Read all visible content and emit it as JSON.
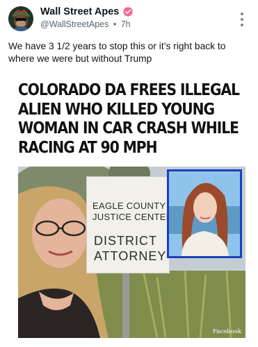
{
  "post": {
    "display_name": "Wall Street Apes",
    "handle": "@WallStreetApes",
    "separator": "•",
    "timestamp": "7h",
    "text": "We have 3 1/2 years to stop this or it’s right back to where we were but without Trump"
  },
  "icons": {
    "avatar": "ape-avatar",
    "verified": "verified-badge-icon",
    "more": "more-vertical-icon"
  },
  "colors": {
    "verified_badge": "#f6658b",
    "inset_border": "#1c3fbf",
    "secondary_text": "#536471"
  },
  "media": {
    "headline": "COLORADO DA FREES ILLEGAL ALIEN WHO KILLED YOUNG WOMAN IN CAR CRASH WHILE RACING AT 90 MPH",
    "sign_line1": "EAGLE COUNTY",
    "sign_line2": "JUSTICE CENTER",
    "sign_line3": "DISTRICT",
    "sign_line4": "ATTORNEY",
    "watermark": "Facebook"
  }
}
